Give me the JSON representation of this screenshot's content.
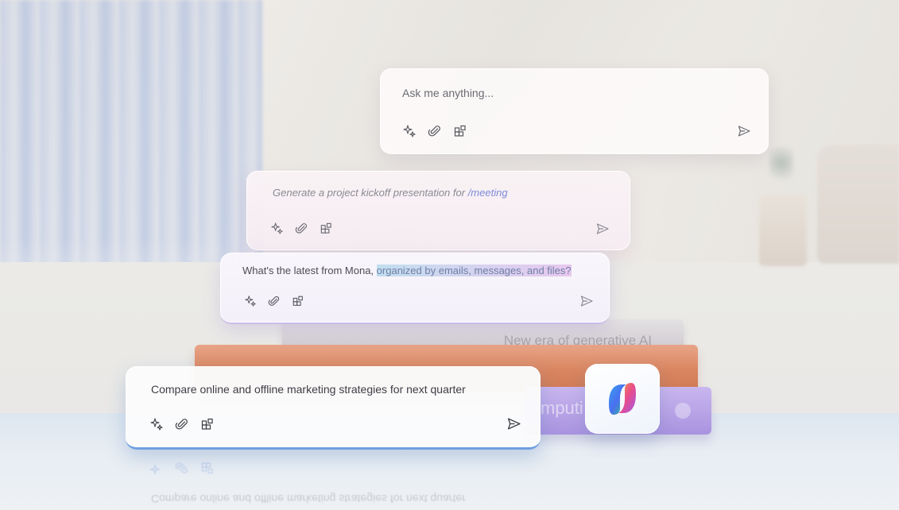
{
  "card_ask": {
    "placeholder": "Ask me anything..."
  },
  "card_generate": {
    "prompt_prefix": "Generate a project kickoff presentation for ",
    "prompt_command": "/meeting"
  },
  "card_latest": {
    "prompt_prefix": "What's the latest from Mona, ",
    "prompt_highlight": "organized by emails, messages, and files?"
  },
  "card_compare": {
    "prompt": "Compare online and offline marketing strategies for next quarter"
  },
  "book_spine": {
    "gray_title": "New era of generative AI",
    "purple_title": "mputi"
  },
  "reflection": {
    "prompt": "Compare online and offline marketing strategies for next quarter"
  },
  "icons": {
    "sparkle": "sparkle-icon",
    "attach": "paperclip-icon",
    "apps": "apps-grid-icon",
    "send": "send-icon",
    "logo": "copilot-logo-icon"
  },
  "colors": {
    "accent_blue": "#6f9fe0",
    "command_purple": "#7d8ad8",
    "book_orange": "#d9855f",
    "book_purple": "#a993e0"
  }
}
